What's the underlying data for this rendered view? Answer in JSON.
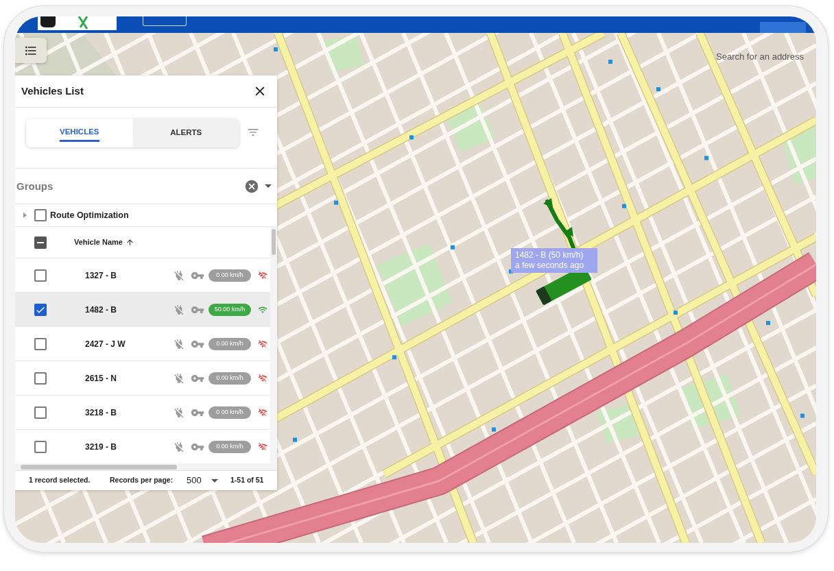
{
  "panel": {
    "title": "Vehicles List",
    "tabs": [
      {
        "label": "VEHICLES",
        "selected": true
      },
      {
        "label": "ALERTS",
        "selected": false
      }
    ],
    "groups_field": {
      "placeholder": "Groups"
    },
    "tree": [
      {
        "label": "Route Optimization",
        "expanded": false,
        "checked": false
      }
    ],
    "table": {
      "header_checkbox": {
        "indeterminate": true
      },
      "columns": [
        {
          "label": "Vehicle Name",
          "sort_ascending": true
        }
      ],
      "rows": [
        {
          "name": "1327 - B",
          "speed": "0.00 km/h",
          "moving": false,
          "selected": false
        },
        {
          "name": "1482 - B",
          "speed": "50.00 km/h",
          "moving": true,
          "selected": true
        },
        {
          "name": "2427 - J W",
          "speed": "0.00 km/h",
          "moving": false,
          "selected": false
        },
        {
          "name": "2615 - N",
          "speed": "0.00 km/h",
          "moving": false,
          "selected": false
        },
        {
          "name": "3218 - B",
          "speed": "0.00 km/h",
          "moving": false,
          "selected": false
        },
        {
          "name": "3219 - B",
          "speed": "0.00 km/h",
          "moving": false,
          "selected": false
        }
      ]
    },
    "footer": {
      "selection": "1 record selected.",
      "per_page_label": "Records per page:",
      "per_page": "500",
      "range": "1-51 of 51"
    }
  },
  "map": {
    "search": {
      "placeholder": "Search for an address"
    },
    "tooltip": {
      "title": "1482 - B (50 km/h)",
      "subtitle": "a few seconds ago"
    }
  }
}
